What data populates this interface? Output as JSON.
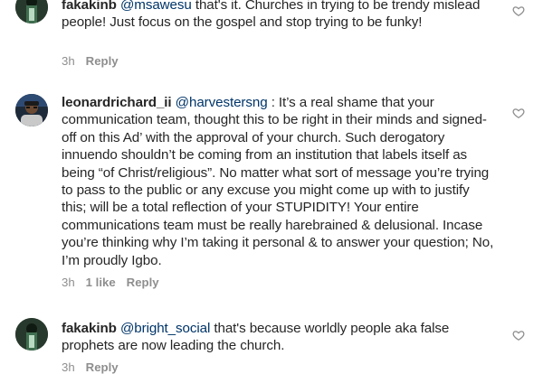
{
  "comments": [
    {
      "username": "fakakinb",
      "mention": "@msawesu",
      "text": " that's it. Churches in trying to be trendy mislead people! Just focus on the gospel and stop trying to be funky!",
      "time": "3h",
      "likes": "",
      "reply_label": "Reply"
    },
    {
      "username": "leonardrichard_ii",
      "mention": "@harvestersng",
      "text": " : It’s a real shame that your communication team, thought this to be right in their minds and signed-off on this Ad’ with the approval of your church. Such derogatory innuendo shouldn’t be coming from an institution that labels itself as being “of Christ/religious”. No matter what sort of message you’re trying to pass to the public or any excuse you might come up with to justify this; will be a total reflection of your STUPIDITY! Your entire communications team must be really harebrained & delusional. Incase you’re thinking why I’m taking it personal & to answer your question; No, I’m proudly Igbo.",
      "time": "3h",
      "likes": "1 like",
      "reply_label": "Reply"
    },
    {
      "username": "fakakinb",
      "mention": "@bright_social",
      "text": " that's because worldly people aka false prophets are now leading the church.",
      "time": "3h",
      "likes": "",
      "reply_label": "Reply"
    }
  ],
  "icons": {
    "like": "heart-outline-icon",
    "avatar": "profile-picture"
  },
  "colors": {
    "text": "#262626",
    "mention": "#003569",
    "meta": "#8e8e8e"
  }
}
